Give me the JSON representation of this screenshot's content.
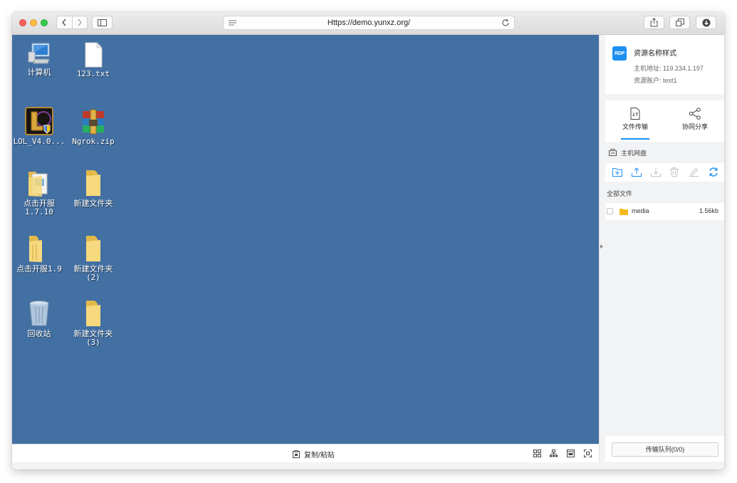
{
  "browser": {
    "url": "Https://demo.yunxz.org/"
  },
  "desktop": {
    "icons": [
      {
        "name": "computer",
        "label": "计算机",
        "label2": ""
      },
      {
        "name": "text-file",
        "label": "123.txt",
        "label2": ""
      },
      {
        "name": "lol-app",
        "label": "LOL_V4.0...",
        "label2": ""
      },
      {
        "name": "zip-archive",
        "label": "Ngrok.zip",
        "label2": ""
      },
      {
        "name": "folder-1710",
        "label": "点击开服",
        "label2": "1.7.10"
      },
      {
        "name": "new-folder",
        "label": "新建文件夹",
        "label2": ""
      },
      {
        "name": "folder-19",
        "label": "点击开服1.9",
        "label2": ""
      },
      {
        "name": "new-folder-2",
        "label": "新建文件夹",
        "label2": "(2)"
      },
      {
        "name": "recycle-bin",
        "label": "回收站",
        "label2": ""
      },
      {
        "name": "new-folder-3",
        "label": "新建文件夹",
        "label2": "(3)"
      }
    ],
    "background_color": "#4370a3"
  },
  "bottom_bar": {
    "copy_paste_label": "复制/粘贴"
  },
  "panel": {
    "resource": {
      "badge": "RDP",
      "title": "资源名称样式",
      "host_line": "主机地址: 119.234.1.197",
      "account_line": "资源账户: test1"
    },
    "tabs": [
      {
        "label": "文件传输",
        "active": true
      },
      {
        "label": "协同分享",
        "active": false
      }
    ],
    "disk_label": "主机网盘",
    "all_files_label": "全部文件",
    "files": [
      {
        "name": "media",
        "size": "1.56kb"
      }
    ],
    "queue_label": "传输队列(0/0)",
    "accent_color": "#1c8ff0"
  }
}
